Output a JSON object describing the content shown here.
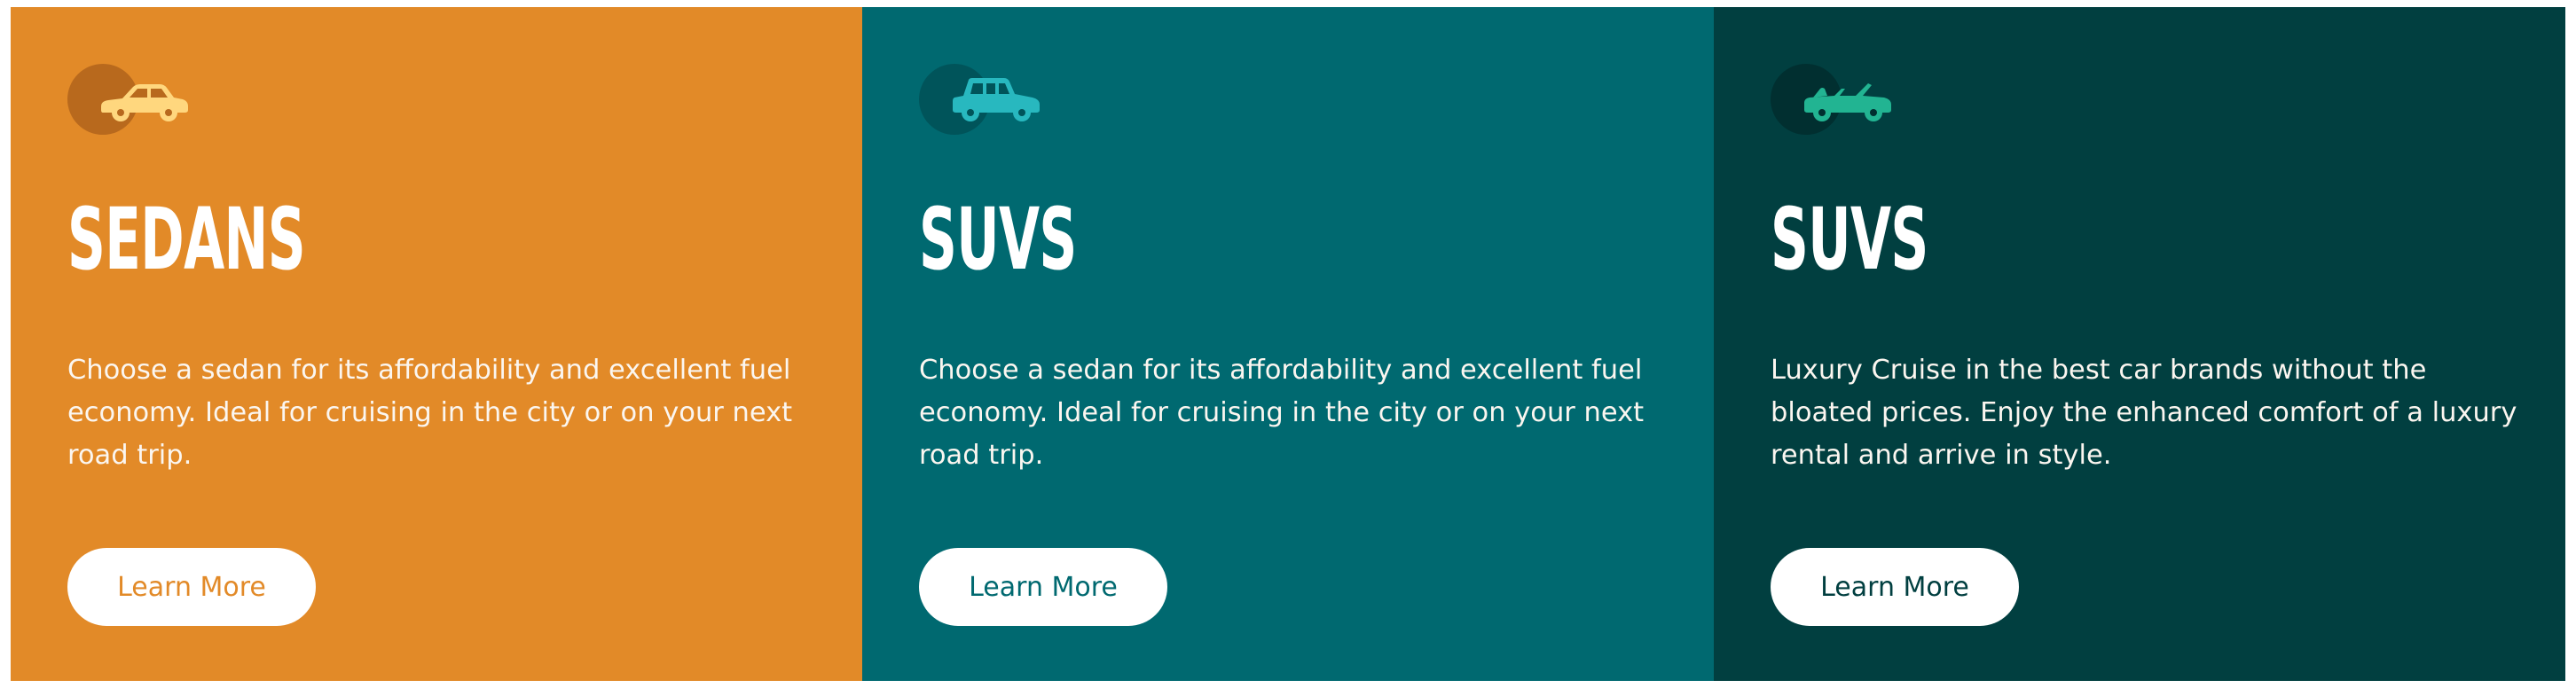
{
  "cards": [
    {
      "title": "SEDANS",
      "description": "Choose a sedan for its affordability and excellent fuel economy. Ideal for cruising in the city or on your next road trip.",
      "button_label": "Learn More",
      "icon": "sedan-car-icon",
      "background_color": "#e28a28",
      "icon_circle_color": "#b8691d",
      "icon_color": "#ffd77e",
      "button_text_color": "#e28a28"
    },
    {
      "title": "SUVS",
      "description": "Choose a sedan for its affordability and excellent fuel economy. Ideal for cruising in the city or on your next road trip.",
      "button_label": "Learn More",
      "icon": "suv-car-icon",
      "background_color": "#006970",
      "icon_circle_color": "#00545a",
      "icon_color": "#28b8bf",
      "button_text_color": "#006970"
    },
    {
      "title": "SUVS",
      "description": "Luxury Cruise in the best car brands without the bloated prices. Enjoy the enhanced comfort of a luxury rental and arrive in style.",
      "button_label": "Learn More",
      "icon": "convertible-car-icon",
      "background_color": "#013f40",
      "icon_circle_color": "#012f30",
      "icon_color": "#22b492",
      "button_text_color": "#013f40"
    }
  ]
}
